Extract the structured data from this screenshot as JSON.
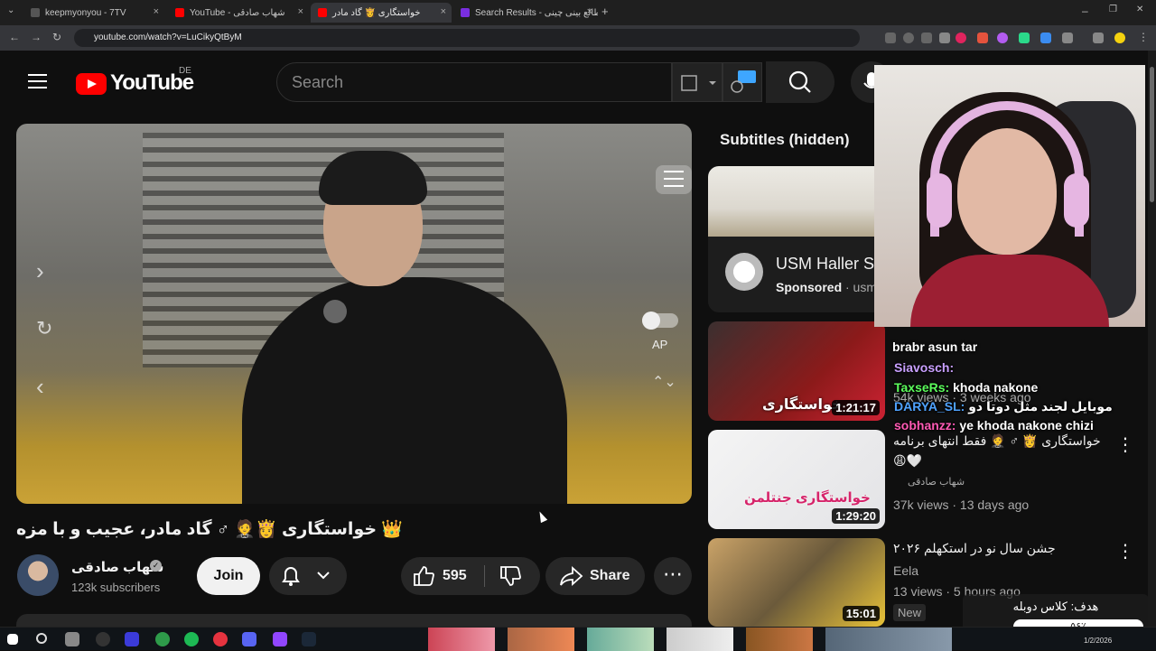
{
  "browser": {
    "tabs": [
      {
        "title": "keepmyonyou - 7TV",
        "color": "#3a3a3a",
        "active": false
      },
      {
        "title": "YouTube - شهاب صادقی",
        "color": "#ff0000",
        "active": false
      },
      {
        "title": "خواستگاری 👸 گاد مادر",
        "color": "#ff0000",
        "active": true
      },
      {
        "title": "Search Results - طالع بینی چینی",
        "color": "#7a2ee0",
        "active": false
      }
    ],
    "new_tab": "+",
    "close_glyph": "×",
    "url": "youtube.com/watch?v=LuCikyQtByM",
    "window_controls": [
      "–",
      "❐",
      "✕"
    ],
    "accent": "#ff0000"
  },
  "masthead": {
    "logo_text": "YouTube",
    "region": "DE",
    "search_placeholder": "Search"
  },
  "video": {
    "title": "👑 خواستگاری 👸🤵 ♂ گاد مادر، عجیب و با مزه",
    "channel": "شهاب صادقی",
    "verified_glyph": "✓",
    "subscribers": "123k subscribers",
    "join_label": "Join",
    "likes": "595",
    "share_label": "Share",
    "more_glyph": "⋯",
    "autoplay_label": "AP"
  },
  "sidebar": {
    "subtitles_label": "Subtitles (hidden)",
    "ad": {
      "title": "USM Haller S",
      "sponsored": "Sponsored",
      "domain": "· usm"
    },
    "recommendations": [
      {
        "duration": "1:21:17",
        "meta": "54k views · 3 weeks ago",
        "thumb_color": "#b31b1b",
        "thumb_label": "خواستگاری"
      },
      {
        "duration": "1:29:20",
        "title": "خواستگاری 👸 ♂ 🤵 فقط انتهای برنامه",
        "title2": "😩🤍",
        "channel": "شهاب صادقی",
        "meta": "37k views · 13 days ago",
        "thumb_color": "#e9e9ea",
        "thumb_label": "خواستگاری جنتلمن"
      },
      {
        "duration": "15:01",
        "title": "جشن سال نو در استکهلم ۲۰۲۶",
        "channel": "Eela",
        "meta": "13 views · 5 hours ago",
        "badge": "New",
        "thumb_color": "#6b5a3b",
        "thumb_label": ""
      }
    ]
  },
  "chat": [
    {
      "user": "",
      "msg": "brabr asun tar",
      "color": "#ffffff"
    },
    {
      "user": "Siavosch:",
      "msg": "",
      "color": "#c9a0ff"
    },
    {
      "user": "TaxseRs:",
      "msg": "khoda nakone",
      "color": "#5cff5c"
    },
    {
      "user": "DARYA_SL:",
      "msg": "موبایل لجند مثل دوتا دو",
      "color": "#4fa3ff"
    },
    {
      "user": "sobhanzz:",
      "msg": "ye khoda nakone chizi",
      "color": "#ff5ab4"
    }
  ],
  "goal": {
    "label": "هدف: کلاس دوبله",
    "progress_text": "۵۶٪",
    "progress": 0.56
  },
  "taskbar": {
    "date": "1/2/2026"
  }
}
